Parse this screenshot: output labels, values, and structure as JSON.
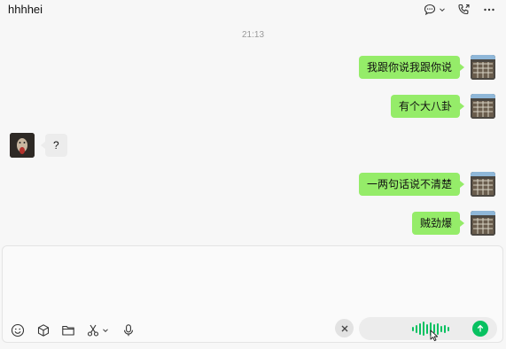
{
  "header": {
    "title": "hhhhei",
    "icons": [
      "chat-bubble-icon",
      "chevron-down-icon",
      "call-icon",
      "more-icon"
    ]
  },
  "chat": {
    "timestamp": "21:13",
    "messages": [
      {
        "side": "me",
        "text": "我跟你说我跟你说"
      },
      {
        "side": "me",
        "text": "有个大八卦"
      },
      {
        "side": "other",
        "text": "?"
      },
      {
        "side": "me",
        "text": "一两句话说不清楚"
      },
      {
        "side": "me",
        "text": "贼劲爆"
      }
    ]
  },
  "toolbar": {
    "icons": [
      "emoji-icon",
      "cube-icon",
      "folder-icon",
      "scissors-icon",
      "chevron-down-icon",
      "microphone-icon"
    ]
  },
  "voice_input": {
    "clear_icon": "close-icon",
    "send_icon": "arrow-up-icon",
    "accent": "#07c160"
  },
  "colors": {
    "my_bubble": "#95ec69",
    "other_bubble": "#ececec",
    "accent": "#07c160"
  }
}
